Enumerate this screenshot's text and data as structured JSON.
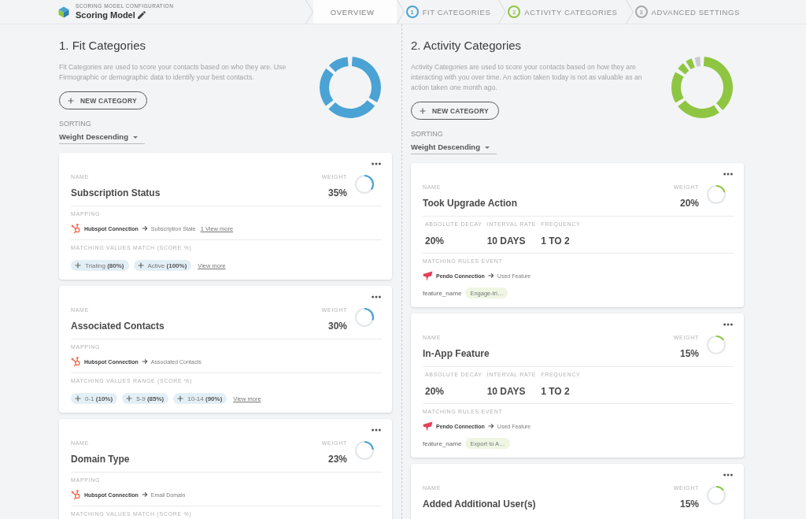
{
  "header": {
    "caption": "SCORING MODEL CONFIGURATION",
    "title": "Scoring Model"
  },
  "steps": [
    {
      "label": "OVERVIEW",
      "selected": true
    },
    {
      "number": "1",
      "label": "FIT CATEGORIES",
      "color": "#4aa3d4",
      "selected": false
    },
    {
      "number": "2",
      "label": "ACTIVITY CATEGORIES",
      "color": "#8ec641",
      "selected": false
    },
    {
      "number": "3",
      "label": "ADVANCED SETTINGS",
      "color": "#a8a8a8",
      "selected": false
    }
  ],
  "sections": [
    {
      "kind": "fit",
      "title": "1. Fit Categories",
      "description": "Fit Categories are used to score your contacts based on who they are. Use Firmographic or demographic data to identify your best contacts.",
      "button": "NEW CATEGORY",
      "sorting_label": "SORTING",
      "sorting_value": "Weight Descending",
      "cards": [
        {
          "kind": "fit",
          "name_label": "NAME",
          "name": "Subscription Status",
          "weight_label": "WEIGHT",
          "weight": "35%",
          "level": 0.35,
          "mapping_label": "MAPPING",
          "source": "Hubspot Connection",
          "target": "Subscription State",
          "mapping_link": "1 View more",
          "values_label": "MATCHING VALUES MATCH (SCORE %)",
          "values": [
            "Trialing **(80%)**",
            "Active **(100%)**"
          ],
          "values_link": "View more"
        },
        {
          "kind": "fit",
          "name_label": "NAME",
          "name": "Associated Contacts",
          "weight_label": "WEIGHT",
          "weight": "30%",
          "level": 0.3,
          "mapping_label": "MAPPING",
          "source": "Hubspot Connection",
          "target": "Associated Contacts",
          "values_label": "MATCHING VALUES RANGE (SCORE %)",
          "values": [
            "0-1 **(10%)**",
            "5-9 **(85%)**",
            "10-14 **(90%)**"
          ],
          "values_link": "View more"
        },
        {
          "kind": "fit",
          "name_label": "NAME",
          "name": "Domain Type",
          "weight_label": "WEIGHT",
          "weight": "23%",
          "level": 0.23,
          "mapping_label": "MAPPING",
          "source": "Hubspot Connection",
          "target": "Email Domain",
          "values_label": "MATCHING VALUES MATCH (SCORE %)"
        }
      ]
    },
    {
      "kind": "activity",
      "title": "2. Activity Categories",
      "description": "Activity Categories are used to score your contacts based on how they are interacting with you over time. An action taken today is not as valuable as an action taken one month ago.",
      "button": "NEW CATEGORY",
      "sorting_label": "SORTING",
      "sorting_value": "Weight Descending",
      "cards": [
        {
          "kind": "activity",
          "name_label": "NAME",
          "name": "Took Upgrade Action",
          "weight_label": "WEIGHT",
          "weight": "20%",
          "level": 0.2,
          "stats": [
            {
              "label": "ABSOLUTE DECAY",
              "value": "20%"
            },
            {
              "label": "INTERVAL RATE",
              "value": "10 DAYS"
            },
            {
              "label": "FREQUENCY",
              "value": "1 TO 2"
            }
          ],
          "rules_label": "MATCHING RULES EVENT",
          "source": "Pendo Connection",
          "target": "Used Feature",
          "property": "feature_name",
          "property_value": "Engage-tri…"
        },
        {
          "kind": "activity",
          "name_label": "NAME",
          "name": "In-App Feature",
          "weight_label": "WEIGHT",
          "weight": "15%",
          "level": 0.15,
          "stats": [
            {
              "label": "ABSOLUTE DECAY",
              "value": "20%"
            },
            {
              "label": "INTERVAL RATE",
              "value": "10 DAYS"
            },
            {
              "label": "FREQUENCY",
              "value": "1 TO 2"
            }
          ],
          "rules_label": "MATCHING RULES EVENT",
          "source": "Pendo Connection",
          "target": "Used Feature",
          "property": "feature_name",
          "property_value": "Export to A…"
        },
        {
          "kind": "activity",
          "name_label": "NAME",
          "name": "Added Additional User(s)",
          "weight_label": "WEIGHT",
          "weight": "15%",
          "level": 0.15
        }
      ]
    }
  ]
}
